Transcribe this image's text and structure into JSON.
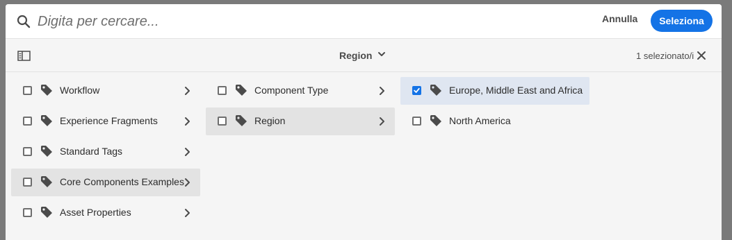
{
  "search": {
    "placeholder": "Digita per cercare..."
  },
  "actions": {
    "cancel_label": "Annulla",
    "select_label": "Seleziona"
  },
  "toolbar": {
    "breadcrumb": "Region",
    "selection_count": "1 selezionato/i"
  },
  "columns": [
    {
      "items": [
        {
          "label": "Workflow",
          "has_children": true,
          "checked": false,
          "active": false
        },
        {
          "label": "Experience Fragments",
          "has_children": true,
          "checked": false,
          "active": false
        },
        {
          "label": "Standard Tags",
          "has_children": true,
          "checked": false,
          "active": false
        },
        {
          "label": "Core Components Examples",
          "has_children": true,
          "checked": false,
          "active": true
        },
        {
          "label": "Asset Properties",
          "has_children": true,
          "checked": false,
          "active": false
        }
      ]
    },
    {
      "items": [
        {
          "label": "Component Type",
          "has_children": true,
          "checked": false,
          "active": false
        },
        {
          "label": "Region",
          "has_children": true,
          "checked": false,
          "active": true
        }
      ]
    },
    {
      "items": [
        {
          "label": "Europe, Middle East and Africa",
          "has_children": false,
          "checked": true,
          "active": false
        },
        {
          "label": "North America",
          "has_children": false,
          "checked": false,
          "active": false
        }
      ]
    }
  ],
  "colors": {
    "accent": "#1473e6",
    "active_row": "#e3e3e3",
    "selected_row": "#dfe6f1",
    "icon": "#4b4b4b"
  }
}
